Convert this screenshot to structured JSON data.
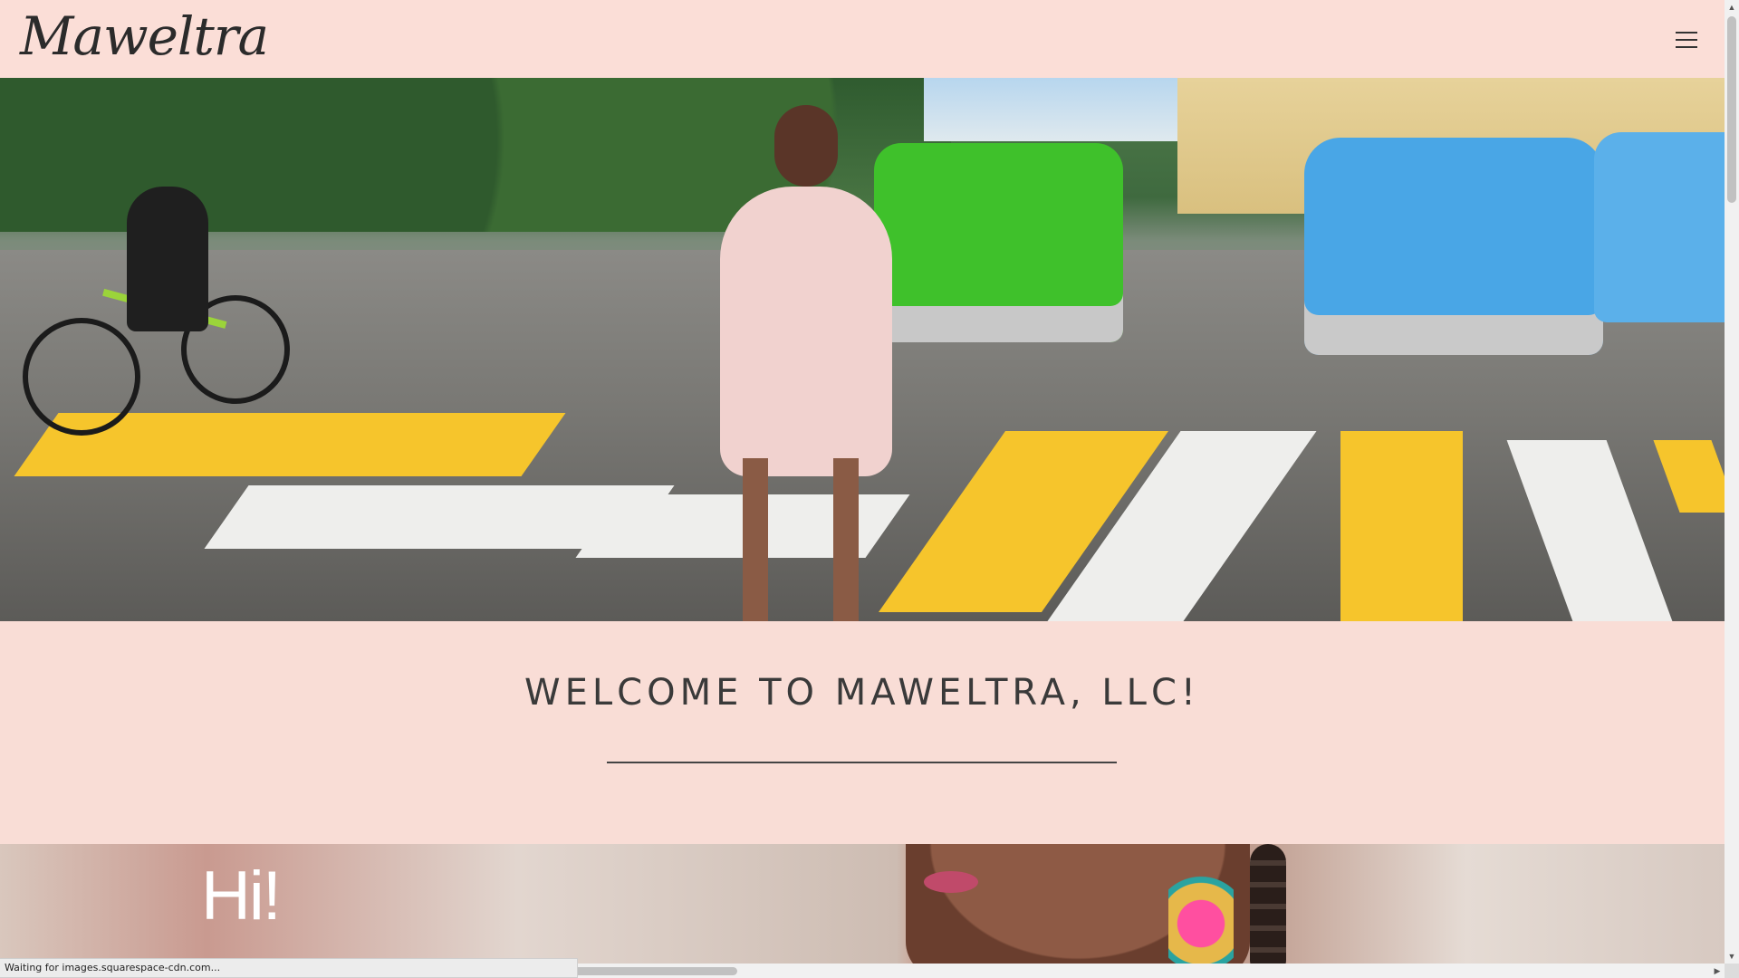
{
  "header": {
    "logo_text": "Maweltra",
    "menu_icon": "hamburger-menu-icon"
  },
  "hero": {
    "image_description_visible": ""
  },
  "welcome": {
    "title": "WELCOME TO MAWELTRA, LLC!"
  },
  "second_section": {
    "greeting": "Hi!"
  },
  "browser": {
    "status_text": "Waiting for images.squarespace-cdn.com...",
    "scroll_up_icon": "▲",
    "scroll_down_icon": "▼",
    "scroll_right_icon": "▶"
  },
  "colors": {
    "page_background": "#f9ddd6",
    "text_dark": "#3a3a3a",
    "crosswalk_yellow": "#f6c52c",
    "crosswalk_white": "#f1f1ef"
  }
}
